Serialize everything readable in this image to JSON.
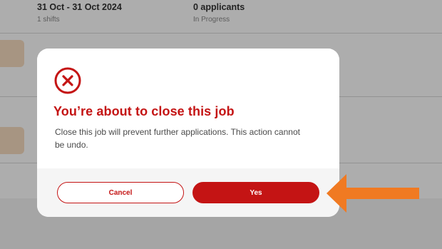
{
  "background": {
    "jobs": [
      {
        "date_range": "31 Oct - 31 Oct 2024",
        "shifts": "1 shifts",
        "applicants": "0 applicants",
        "status": "In Progress"
      }
    ]
  },
  "dialog": {
    "icon": "close-circle-icon",
    "title": "You’re about to close this job",
    "message": "Close this job will prevent further applications. This action cannot be undo.",
    "cancel_label": "Cancel",
    "confirm_label": "Yes"
  },
  "colors": {
    "brand_red": "#c41414",
    "annotation_orange": "#f07a22",
    "thumb_peach": "#f6dcc0"
  }
}
